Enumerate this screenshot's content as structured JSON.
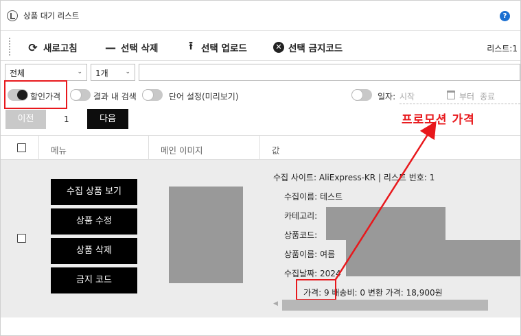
{
  "window": {
    "title": "상품 대기 리스트",
    "help": "?"
  },
  "toolbar": {
    "refresh": "새로고침",
    "delete_selected": "선택 삭제",
    "upload_selected": "선택 업로드",
    "ban_code_selected": "선택 금지코드",
    "list_count": "리스트:1"
  },
  "filters": {
    "scope": "전체",
    "count": "1개",
    "search_value": ""
  },
  "toggles": {
    "discount_price": "할인가격",
    "search_in_results": "결과 내 검색",
    "word_settings": "단어 설정(미리보기)",
    "date": "일자:",
    "date_start_placeholder": "시작",
    "date_from": "부터",
    "date_end_placeholder": "종료"
  },
  "pager": {
    "prev": "이전",
    "page": "1",
    "next": "다음"
  },
  "annotation": {
    "text": "프로모션 가격",
    "color": "#e8181c"
  },
  "table": {
    "headers": [
      "메뉴",
      "메인 이미지",
      "값"
    ]
  },
  "row": {
    "actions": [
      "수집 상품 보기",
      "상품 수정",
      "상품 삭제",
      "금지 코드"
    ],
    "info": {
      "site_line": "수집 사이트: AliExpress-KR | 리스트 번호: 1",
      "collect_name": "수집이름: 테스트",
      "category": "카테고리:",
      "product_code": "상품코드:",
      "product_name": "상품이름: 여름",
      "collect_date": "수집날짜: 2024",
      "price_line": "가격: 9  배송비: 0  변환 가격: 18,900원"
    }
  },
  "colors": {
    "highlight": "#e8181c",
    "button": "#000000",
    "help": "#1a6fd1"
  }
}
